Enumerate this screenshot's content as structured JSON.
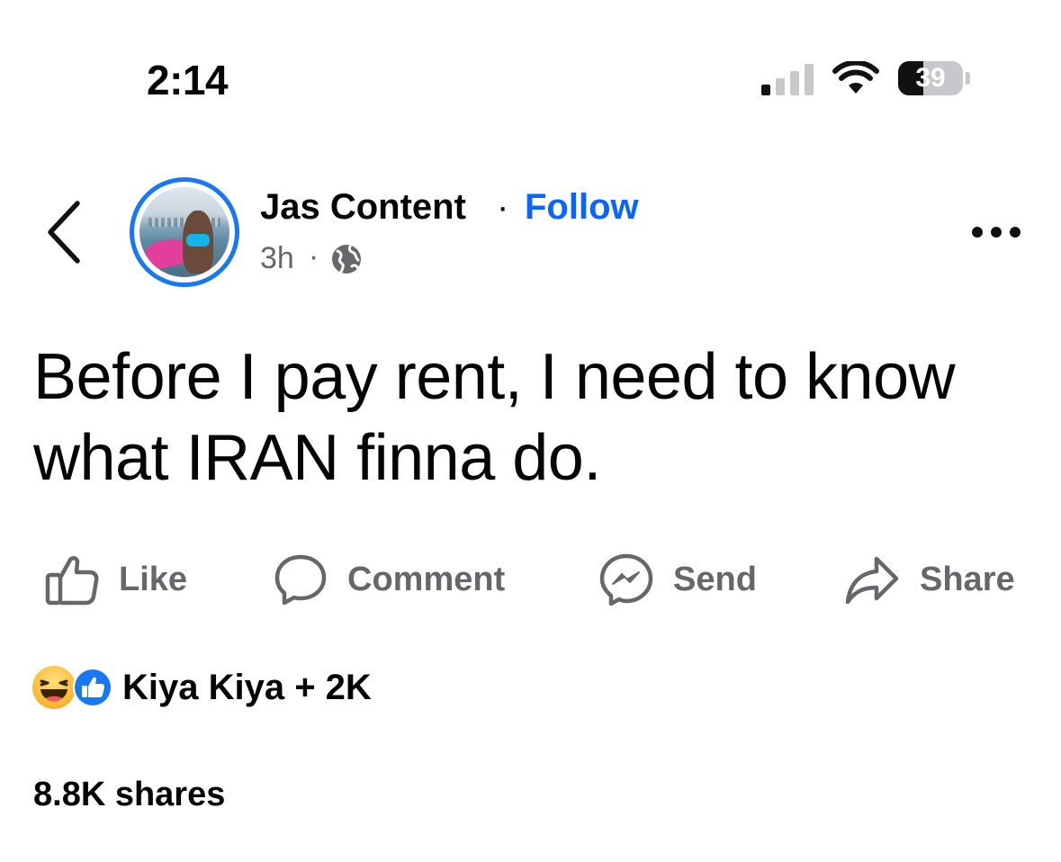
{
  "status_bar": {
    "time": "2:14",
    "signal_icon": "cellular-signal-icon",
    "wifi_icon": "wifi-icon",
    "battery_level": "39",
    "battery_fraction": 0.39
  },
  "header": {
    "back_icon": "chevron-left-icon",
    "author_name": "Jas Content",
    "separator": "·",
    "follow_label": "Follow",
    "post_age": "3h",
    "meta_separator": "·",
    "audience_icon": "globe-icon",
    "more_icon": "more-options-icon",
    "accent_color": "#0866ff"
  },
  "post": {
    "text": "Before I pay rent, I need to know what IRAN finna do."
  },
  "actions": {
    "like_label": "Like",
    "comment_label": "Comment",
    "send_label": "Send",
    "share_label": "Share"
  },
  "engagement": {
    "reaction_icons": [
      "haha-reaction-icon",
      "like-reaction-icon"
    ],
    "reactors_text": "Kiya Kiya + 2K",
    "shares_text": "8.8K shares"
  }
}
